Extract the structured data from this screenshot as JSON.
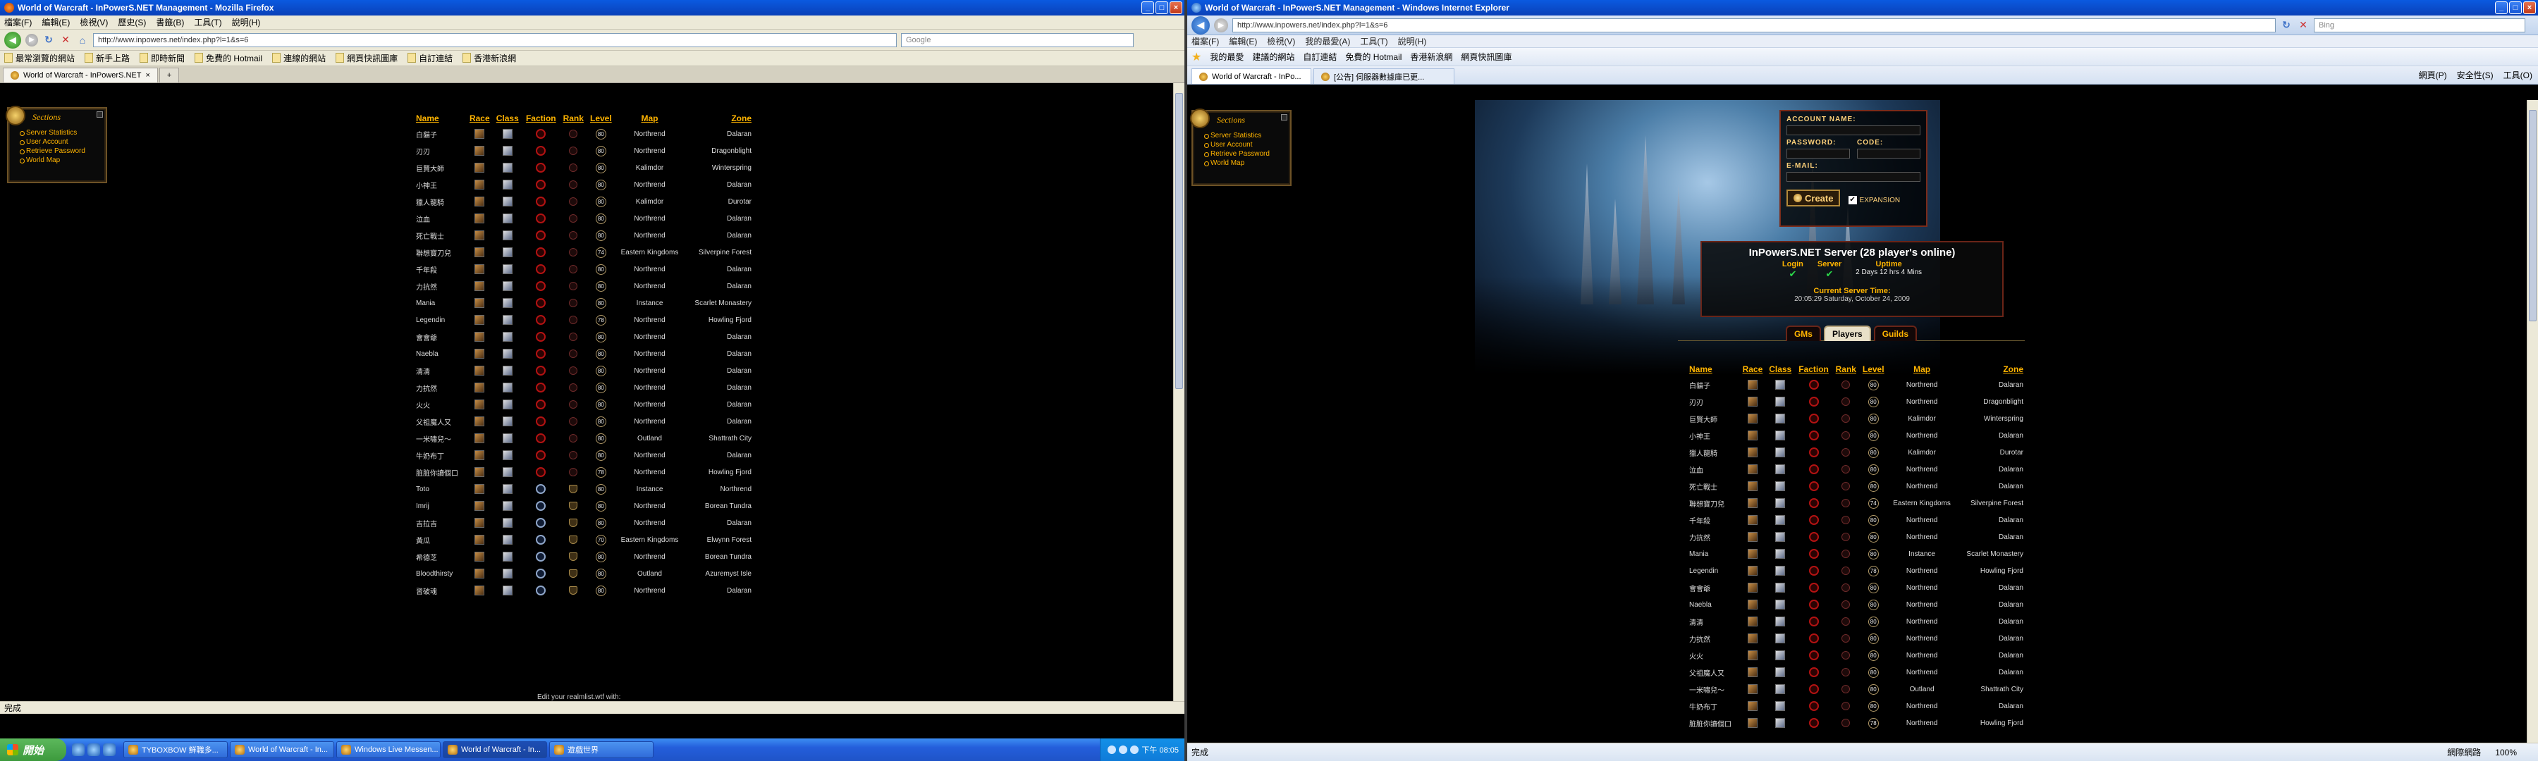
{
  "left_window": {
    "title": "World of Warcraft - InPowerS.NET Management - Mozilla Firefox",
    "menu": [
      "檔案(F)",
      "編輯(E)",
      "檢視(V)",
      "歷史(S)",
      "書籤(B)",
      "工具(T)",
      "說明(H)"
    ],
    "url": "http://www.inpowers.net/index.php?l=1&s=6",
    "search_placeholder": "Google",
    "bookmarks": [
      "最常瀏覽的網站",
      "新手上路",
      "即時新聞",
      "免費的 Hotmail",
      "連線的網站",
      "網頁快訊圖庫",
      "自訂連結",
      "香港新浪網"
    ],
    "tab_label": "World of Warcraft - InPowerS.NET",
    "status": "完成",
    "footer_text": "Edit your realmlist.wtf with:"
  },
  "right_window": {
    "title": "World of Warcraft - InPowerS.NET Management - Windows Internet Explorer",
    "url": "http://www.inpowers.net/index.php?l=1&s=6",
    "search_placeholder": "Bing",
    "menu": [
      "檔案(F)",
      "編輯(E)",
      "檢視(V)",
      "我的最愛(A)",
      "工具(T)",
      "說明(H)"
    ],
    "favorites_label": "我的最愛",
    "favorites": [
      "建議的網站",
      "自訂連結",
      "免費的 Hotmail",
      "香港新浪網",
      "網頁快訊圖庫"
    ],
    "tabs": [
      "World of Warcraft - InPo...",
      "[公告] 伺服器數據庫已更..."
    ],
    "commands": [
      "網頁(P)",
      "安全性(S)",
      "工具(O)"
    ],
    "status": "完成",
    "zone_text": "網際網路",
    "zoom": "100%"
  },
  "sections": {
    "title": "Sections",
    "items": [
      "Server Statistics",
      "User Account",
      "Retrieve Password",
      "World Map"
    ]
  },
  "login": {
    "account_label": "ACCOUNT NAME:",
    "password_label": "PASSWORD:",
    "code_label": "CODE:",
    "email_label": "E-MAIL:",
    "create_label": "Create",
    "expansion_label": "EXPANSION"
  },
  "server": {
    "title": "InPowerS.NET Server (28 player's online)",
    "login_label": "Login",
    "server_label": "Server",
    "uptime_label": "Uptime",
    "uptime_value": "2 Days 12 hrs 4 Mins",
    "time_label": "Current Server Time:",
    "time_value": "20:05:29 Saturday, October 24, 2009"
  },
  "info_tabs": [
    "GMs",
    "Players",
    "Guilds"
  ],
  "table_headers": {
    "name": "Name",
    "race": "Race",
    "class": "Class",
    "faction": "Faction",
    "rank": "Rank",
    "level": "Level",
    "map": "Map",
    "zone": "Zone"
  },
  "players": [
    {
      "name": "白貓子",
      "level": "80",
      "map": "Northrend",
      "zone": "Dalaran"
    },
    {
      "name": "刃刃",
      "level": "80",
      "map": "Northrend",
      "zone": "Dragonblight"
    },
    {
      "name": "巨賢大師",
      "level": "80",
      "map": "Kalimdor",
      "zone": "Winterspring"
    },
    {
      "name": "小神王",
      "level": "80",
      "map": "Northrend",
      "zone": "Dalaran"
    },
    {
      "name": "獵人龍騎",
      "level": "80",
      "map": "Kalimdor",
      "zone": "Durotar"
    },
    {
      "name": "泣血",
      "level": "80",
      "map": "Northrend",
      "zone": "Dalaran"
    },
    {
      "name": "死亡戰士",
      "level": "80",
      "map": "Northrend",
      "zone": "Dalaran"
    },
    {
      "name": "聯想寶刀兒",
      "level": "74",
      "map": "Eastern Kingdoms",
      "zone": "Silverpine Forest"
    },
    {
      "name": "千年殺",
      "level": "80",
      "map": "Northrend",
      "zone": "Dalaran"
    },
    {
      "name": "力抗然",
      "level": "80",
      "map": "Northrend",
      "zone": "Dalaran"
    },
    {
      "name": "Mania",
      "level": "80",
      "map": "Instance",
      "zone": "Scarlet Monastery"
    },
    {
      "name": "Legendin",
      "level": "78",
      "map": "Northrend",
      "zone": "Howling Fjord"
    },
    {
      "name": "會會爺",
      "level": "80",
      "map": "Northrend",
      "zone": "Dalaran"
    },
    {
      "name": "Naebla",
      "level": "80",
      "map": "Northrend",
      "zone": "Dalaran"
    },
    {
      "name": "清清",
      "level": "80",
      "map": "Northrend",
      "zone": "Dalaran"
    },
    {
      "name": "力抗然",
      "level": "80",
      "map": "Northrend",
      "zone": "Dalaran"
    },
    {
      "name": "火火",
      "level": "80",
      "map": "Northrend",
      "zone": "Dalaran"
    },
    {
      "name": "父祖魔人又",
      "level": "80",
      "map": "Northrend",
      "zone": "Dalaran"
    },
    {
      "name": "一米嘯兒～",
      "level": "80",
      "map": "Outland",
      "zone": "Shattrath City"
    },
    {
      "name": "牛奶布丁",
      "level": "80",
      "map": "Northrend",
      "zone": "Dalaran"
    },
    {
      "name": "脏脏你讀個口",
      "level": "78",
      "map": "Northrend",
      "zone": "Howling Fjord"
    },
    {
      "name": "Toto",
      "level": "80",
      "map": "Instance",
      "zone": "Northrend"
    },
    {
      "name": "Imrij",
      "level": "80",
      "map": "Northrend",
      "zone": "Borean Tundra"
    },
    {
      "name": "吉拉吉",
      "level": "80",
      "map": "Northrend",
      "zone": "Dalaran"
    },
    {
      "name": "黃瓜",
      "level": "70",
      "map": "Eastern Kingdoms",
      "zone": "Elwynn Forest"
    },
    {
      "name": "希德芝",
      "level": "80",
      "map": "Northrend",
      "zone": "Borean Tundra"
    },
    {
      "name": "Bloodthirsty",
      "level": "80",
      "map": "Outland",
      "zone": "Azuremyst Isle"
    },
    {
      "name": "習破魂",
      "level": "80",
      "map": "Northrend",
      "zone": "Dalaran"
    }
  ],
  "taskbar": {
    "start_label": "開始",
    "tasks": [
      "TYBOXBOW 鮮職多...",
      "World of Warcraft - In...",
      "Windows Live Messen...",
      "World of Warcraft - In...",
      "遊戲世界"
    ],
    "clock": "下午 08:05"
  },
  "colors": {
    "wow_gold": "#ffb400",
    "horde_red": "#b31212",
    "xp_blue": "#245edb"
  }
}
